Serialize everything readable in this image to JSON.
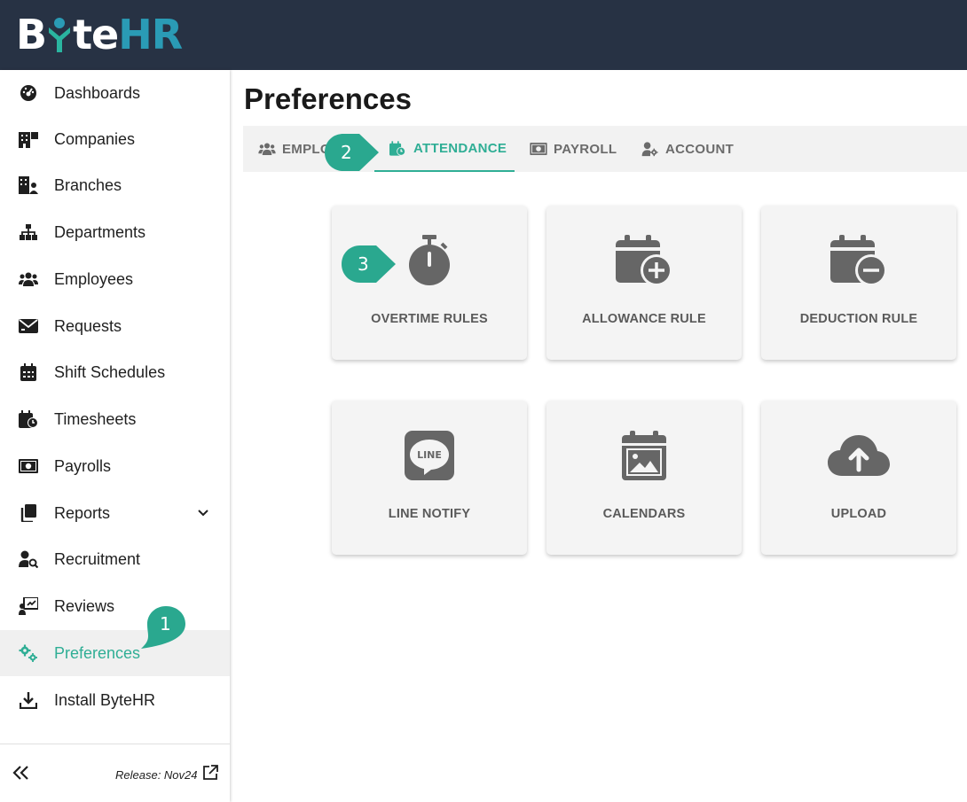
{
  "app": {
    "logo_text_b": "B",
    "logo_text_te": "te",
    "logo_text_hr": "HR"
  },
  "sidebar": {
    "items": [
      {
        "label": "Dashboards",
        "icon": "dashboard-gauge-icon"
      },
      {
        "label": "Companies",
        "icon": "companies-building-icon"
      },
      {
        "label": "Branches",
        "icon": "branches-building-icon"
      },
      {
        "label": "Departments",
        "icon": "sitemap-icon"
      },
      {
        "label": "Employees",
        "icon": "users-icon"
      },
      {
        "label": "Requests",
        "icon": "envelope-icon"
      },
      {
        "label": "Shift Schedules",
        "icon": "calendar-icon"
      },
      {
        "label": "Timesheets",
        "icon": "calendar-clock-icon"
      },
      {
        "label": "Payrolls",
        "icon": "money-bill-icon"
      },
      {
        "label": "Reports",
        "icon": "file-copy-icon"
      },
      {
        "label": "Recruitment",
        "icon": "user-search-icon"
      },
      {
        "label": "Reviews",
        "icon": "chalkboard-user-icon"
      },
      {
        "label": "Preferences",
        "icon": "gears-icon"
      },
      {
        "label": "Install ByteHR",
        "icon": "download-icon"
      }
    ],
    "active_item": "Preferences",
    "release_text": "Release: Nov24"
  },
  "main": {
    "title": "Preferences",
    "tabs": [
      {
        "label": "EMPLO",
        "icon": "users-icon"
      },
      {
        "label": "ATTENDANCE",
        "icon": "calendar-clock-icon"
      },
      {
        "label": "PAYROLL",
        "icon": "money-bill-icon"
      },
      {
        "label": "ACCOUNT",
        "icon": "user-gear-icon"
      }
    ],
    "active_tab": "ATTENDANCE",
    "cards": [
      {
        "label": "OVERTIME RULES",
        "icon": "stopwatch-icon"
      },
      {
        "label": "ALLOWANCE RULE",
        "icon": "calendar-plus-icon"
      },
      {
        "label": "DEDUCTION RULE",
        "icon": "calendar-minus-icon"
      },
      {
        "label": "LINE NOTIFY",
        "icon": "line-icon",
        "icon_text": "LINE"
      },
      {
        "label": "CALENDARS",
        "icon": "calendar-image-icon"
      },
      {
        "label": "UPLOAD",
        "icon": "cloud-upload-icon"
      }
    ]
  },
  "markers": [
    "1",
    "2",
    "3"
  ],
  "colors": {
    "topbar": "#273244",
    "accent": "#2fae95",
    "icon_gray": "#666666"
  }
}
